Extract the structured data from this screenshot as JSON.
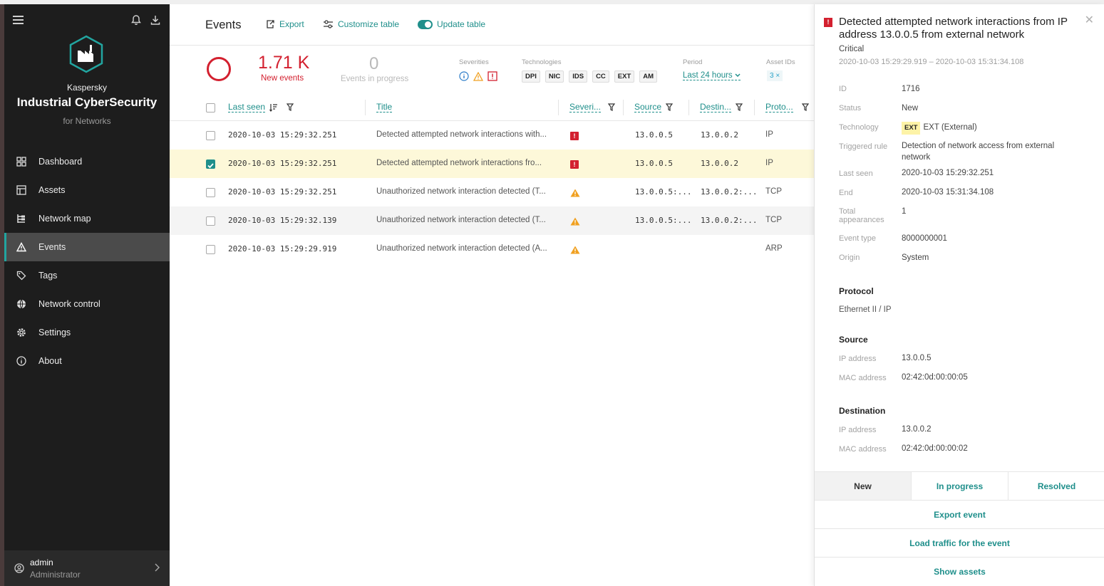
{
  "app": {
    "brand_small": "Kaspersky",
    "brand_big": "Industrial CyberSecurity",
    "brand_sub": "for Networks",
    "accent_color": "#1f8f8b",
    "critical_color": "#d3202f"
  },
  "sidebar": {
    "items": [
      {
        "label": "Dashboard",
        "icon": "dashboard-icon"
      },
      {
        "label": "Assets",
        "icon": "assets-icon"
      },
      {
        "label": "Network map",
        "icon": "network-map-icon"
      },
      {
        "label": "Events",
        "icon": "warning-icon",
        "active": true
      },
      {
        "label": "Tags",
        "icon": "tag-icon"
      },
      {
        "label": "Network control",
        "icon": "globe-icon"
      },
      {
        "label": "Settings",
        "icon": "gear-icon"
      },
      {
        "label": "About",
        "icon": "info-icon"
      }
    ],
    "user": {
      "name": "admin",
      "role": "Administrator"
    }
  },
  "toolbar": {
    "title": "Events",
    "export_label": "Export",
    "customize_label": "Customize table",
    "update_label": "Update table"
  },
  "stats": {
    "new_count": "1.71 K",
    "new_label": "New events",
    "progress_count": "0",
    "progress_label": "Events in progress"
  },
  "filters": {
    "severities_label": "Severities",
    "technologies_label": "Technologies",
    "technologies": [
      "DPI",
      "NIC",
      "IDS",
      "CC",
      "EXT",
      "AM"
    ],
    "period_label": "Period",
    "period_value": "Last 24 hours",
    "asset_ids_label": "Asset IDs",
    "asset_ids_value": "3"
  },
  "table": {
    "columns": [
      "Last seen",
      "Title",
      "Severi...",
      "Source",
      "Destin...",
      "Proto..."
    ],
    "rows": [
      {
        "last_seen": "2020-10-03 15:29:32.251",
        "title": "Detected attempted network interactions with...",
        "severity": "critical",
        "source": "13.0.0.5",
        "dest": "13.0.0.2",
        "proto": "IP",
        "checked": false
      },
      {
        "last_seen": "2020-10-03 15:29:32.251",
        "title": "Detected attempted network interactions fro...",
        "severity": "critical",
        "source": "13.0.0.5",
        "dest": "13.0.0.2",
        "proto": "IP",
        "checked": true
      },
      {
        "last_seen": "2020-10-03 15:29:32.251",
        "title": "Unauthorized network interaction detected (T...",
        "severity": "warning",
        "source": "13.0.0.5:...",
        "dest": "13.0.0.2:...",
        "proto": "TCP",
        "checked": false
      },
      {
        "last_seen": "2020-10-03 15:29:32.139",
        "title": "Unauthorized network interaction detected (T...",
        "severity": "warning",
        "source": "13.0.0.5:...",
        "dest": "13.0.0.2:...",
        "proto": "TCP",
        "checked": false
      },
      {
        "last_seen": "2020-10-03 15:29:29.919",
        "title": "Unauthorized network interaction detected (A...",
        "severity": "warning",
        "source": "",
        "dest": "",
        "proto": "ARP",
        "checked": false
      }
    ]
  },
  "detail": {
    "title": "Detected attempted network interactions from IP address 13.0.0.5 from external network",
    "severity": "Critical",
    "range": "2020-10-03 15:29:29.919 – 2020-10-03 15:31:34.108",
    "fields": {
      "id_label": "ID",
      "id": "1716",
      "status_label": "Status",
      "status": "New",
      "technology_label": "Technology",
      "technology_badge": "EXT",
      "technology": "EXT (External)",
      "rule_label": "Triggered rule",
      "rule": "Detection of network access from external network",
      "last_seen_label": "Last seen",
      "last_seen": "2020-10-03 15:29:32.251",
      "end_label": "End",
      "end": "2020-10-03 15:31:34.108",
      "appearances_label": "Total appearances",
      "appearances": "1",
      "event_type_label": "Event type",
      "event_type": "8000000001",
      "origin_label": "Origin",
      "origin": "System"
    },
    "protocol_heading": "Protocol",
    "protocol": "Ethernet II / IP",
    "source_heading": "Source",
    "source_ip_label": "IP address",
    "source_ip": "13.0.0.5",
    "source_mac_label": "MAC address",
    "source_mac": "02:42:0d:00:00:05",
    "dest_heading": "Destination",
    "dest_ip_label": "IP address",
    "dest_ip": "13.0.0.2",
    "dest_mac_label": "MAC address",
    "dest_mac": "02:42:0d:00:00:02",
    "status_tabs": [
      "New",
      "In progress",
      "Resolved"
    ],
    "actions": [
      "Export event",
      "Load traffic for the event",
      "Show assets"
    ]
  }
}
